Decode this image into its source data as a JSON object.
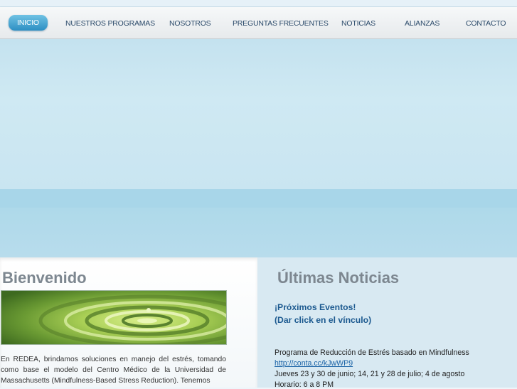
{
  "nav": {
    "items": [
      {
        "label": "INICIO",
        "active": true
      },
      {
        "label": "NUESTROS PROGRAMAS",
        "active": false
      },
      {
        "label": "NOSOTROS",
        "active": false
      },
      {
        "label": "PREGUNTAS FRECUENTES",
        "active": false
      },
      {
        "label": "NOTICIAS",
        "active": false
      },
      {
        "label": "ALIANZAS",
        "active": false
      },
      {
        "label": "CONTACTO",
        "active": false
      }
    ]
  },
  "welcome": {
    "heading": "Bienvenido",
    "body": "En REDEA, brindamos soluciones en manejo del estrés, tomando como base el modelo del Centro Médico de la Universidad de Massachusetts (Mindfulness-Based Stress Reduction). Tenemos"
  },
  "news": {
    "heading": "Últimas Noticias",
    "events_line1": "¡Próximos Eventos!",
    "events_line2": "(Dar click en el vínculo)",
    "program": "Programa de Reducción de Estrés basado en Mindfulness",
    "link": "http://conta.cc/kJwWP9",
    "dates": "Jueves 23 y 30 de junio; 14, 21 y 28 de julio; 4 de agosto",
    "schedule": "Horario: 6 a 8 PM"
  },
  "colors": {
    "nav_active": "#2d8fc3",
    "nav_text": "#2b4a6a",
    "heading": "#7d8790",
    "events": "#1d5a90",
    "link": "#1a63a6"
  }
}
